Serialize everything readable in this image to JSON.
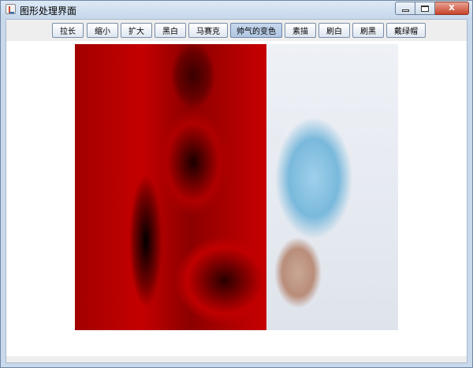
{
  "window": {
    "title": "图形处理界面",
    "close_label": "X"
  },
  "toolbar": {
    "buttons": [
      {
        "label": "拉长"
      },
      {
        "label": "缩小"
      },
      {
        "label": "扩大"
      },
      {
        "label": "黑白"
      },
      {
        "label": "马赛克"
      },
      {
        "label": "帅气的变色",
        "active": true
      },
      {
        "label": "素描"
      },
      {
        "label": "刷白"
      },
      {
        "label": "刷黑"
      },
      {
        "label": "戴绿帽"
      }
    ]
  },
  "canvas": {
    "image": "photo-color-transformed",
    "left_tint": "#c40000",
    "right_tint": "#e8ecf2"
  },
  "colors": {
    "titlebar": "#c9d9ec",
    "button_active": "#b0c6e2",
    "close_button": "#c8432a"
  }
}
